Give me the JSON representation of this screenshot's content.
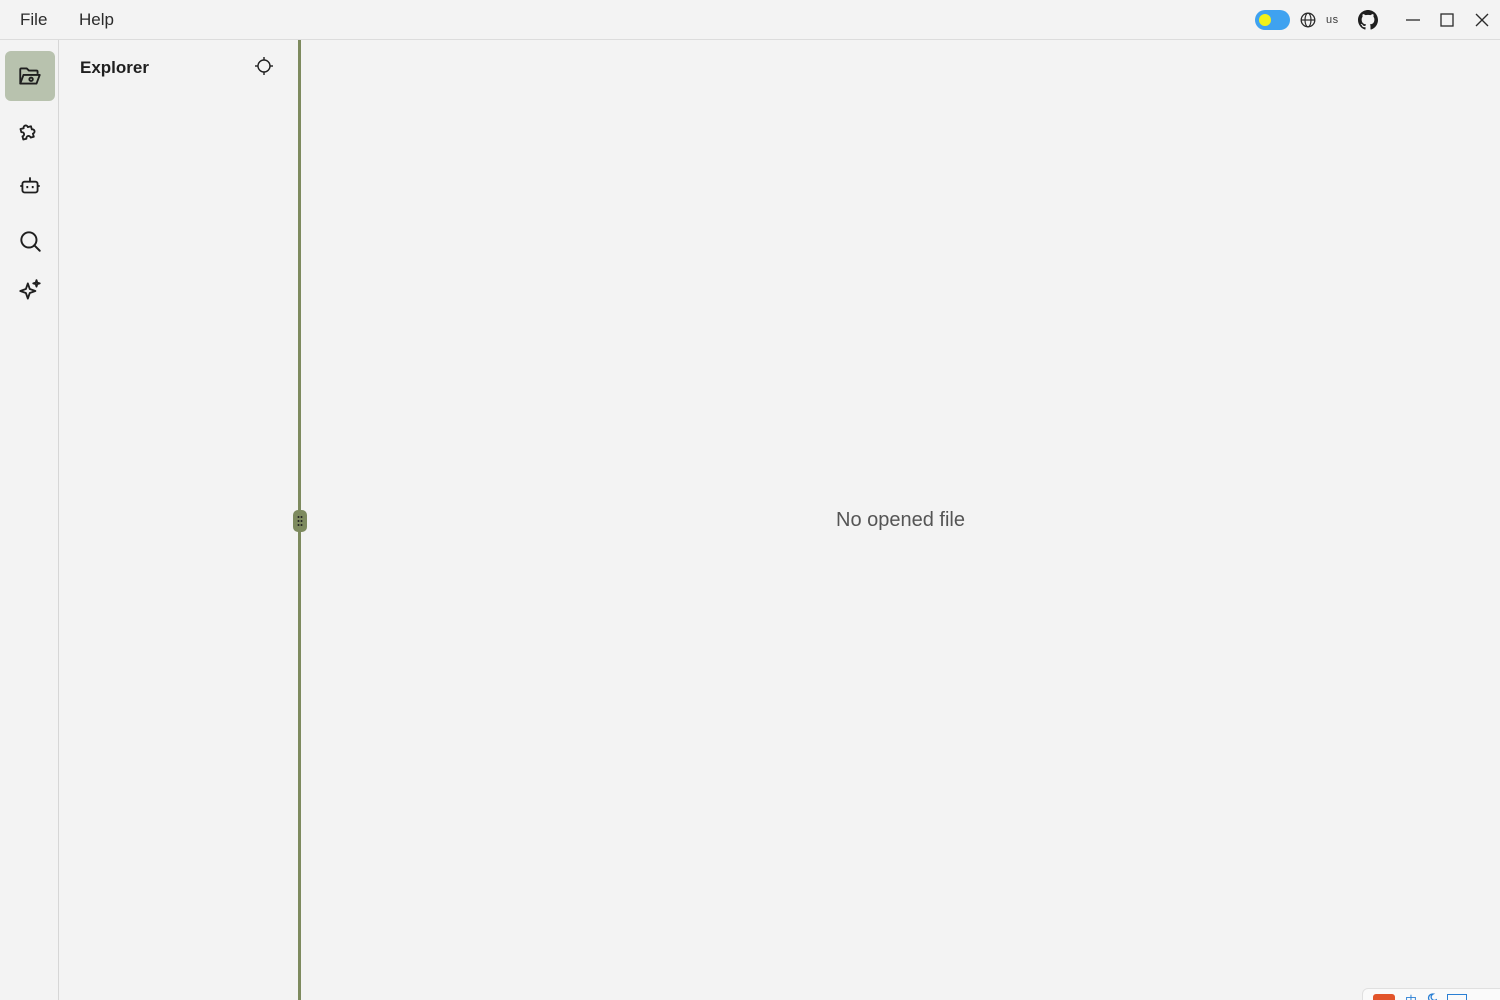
{
  "menu": {
    "file": "File",
    "help": "Help"
  },
  "titlebar": {
    "language": "us",
    "theme_toggle": "light"
  },
  "activitybar": {
    "items": [
      {
        "icon": "folder-open-icon",
        "active": true
      },
      {
        "icon": "puzzle-icon",
        "active": false
      },
      {
        "icon": "robot-icon",
        "active": false
      },
      {
        "icon": "search-icon",
        "active": false
      },
      {
        "icon": "sparkles-icon",
        "active": false
      }
    ]
  },
  "sidebar": {
    "title": "Explorer"
  },
  "editor": {
    "empty_message": "No opened file"
  },
  "tray": {
    "ime_char": "中"
  },
  "colors": {
    "background": "#f3f3f3",
    "accent": "#7d8a5e",
    "active_item": "#b8c2ae",
    "toggle": "#3fa2f0",
    "toggle_knob": "#f2f21a"
  }
}
